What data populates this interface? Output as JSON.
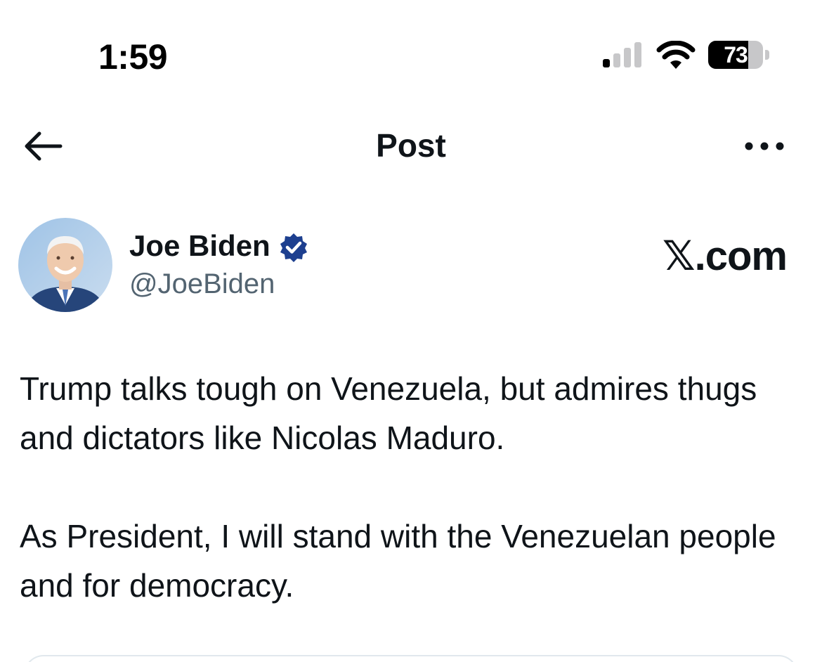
{
  "status_bar": {
    "time": "1:59",
    "battery_level": "73",
    "battery_fraction": 0.73
  },
  "header": {
    "title": "Post",
    "back_icon": "arrow-left-icon",
    "more_icon": "more-horizontal-icon"
  },
  "author": {
    "name": "Joe Biden",
    "handle": "@JoeBiden",
    "verified": true,
    "verified_color": "#1d3f8f"
  },
  "brand": {
    "text": "𝕏.com"
  },
  "post": {
    "paragraphs": [
      "Trump talks tough on Venezuela, but admires thugs and dictators like Nicolas Maduro.",
      "As President, I will stand with the Venezuelan people and for democracy."
    ]
  },
  "colors": {
    "text_primary": "#0f1419",
    "text_secondary": "#536471",
    "background": "#ffffff"
  }
}
